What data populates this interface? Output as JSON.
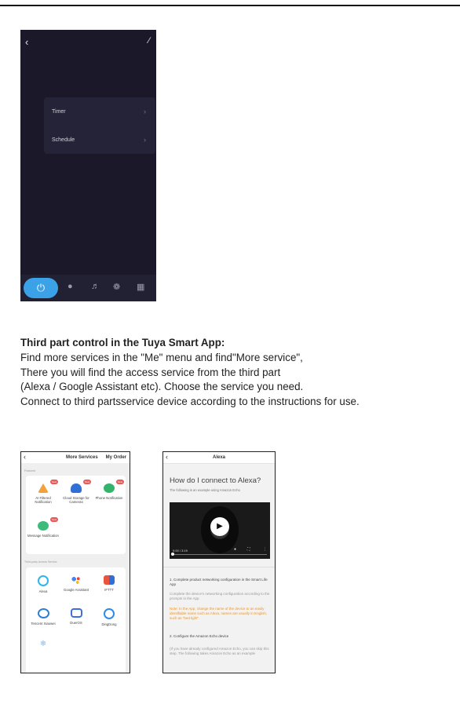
{
  "phone1": {
    "back_icon": "chevron-left-icon",
    "edit_icon": "pencil-icon",
    "rows": [
      {
        "label": "Timer"
      },
      {
        "label": "Schedule"
      }
    ],
    "bottom_icons": [
      "power-icon",
      "bulb-icon",
      "music-icon",
      "palette-icon",
      "grid-icon"
    ],
    "accent_color": "#3ba2e8",
    "background_color": "#1b1929"
  },
  "instructions": {
    "title": "Third part control in the Tuya Smart App:",
    "lines": [
      "Find more services in the \"Me\" menu and find\"More service\",",
      "There you will find the access service from the third part",
      "(Alexa / Google Assistant etc).  Choose the service you need.",
      "Connect to third partsservice device according to the instructions for use."
    ]
  },
  "phone2": {
    "title": "More Services",
    "order": "My Order",
    "featured_label": "Featured",
    "featured": [
      {
        "label": "AI Filtered Notification",
        "icon": "ai-filter-icon",
        "color": "#f2a23a",
        "badge": "New"
      },
      {
        "label": "Cloud Storage for Cameras",
        "icon": "cloud-icon",
        "color": "#2f6fd6",
        "badge": "New"
      },
      {
        "label": "Phone Notification",
        "icon": "phone-icon",
        "color": "#34b36b",
        "badge": "New"
      },
      {
        "label": "Message Notification",
        "icon": "message-icon",
        "color": "#3dbb7a",
        "badge": "New"
      }
    ],
    "third_party_label": "Third-party Access Service",
    "third_party": [
      {
        "label": "Alexa",
        "icon": "alexa-icon",
        "color": "#2fb5e8"
      },
      {
        "label": "Google Assistant",
        "icon": "google-assistant-icon",
        "color": "#4285f4"
      },
      {
        "label": "IFTTT",
        "icon": "ifttt-icon",
        "color": "#e8553a"
      },
      {
        "label": "Tencent Xiaowei",
        "icon": "tencent-icon",
        "color": "#2f7fd6"
      },
      {
        "label": "DuerOS",
        "icon": "dueros-icon",
        "color": "#3d6fe0"
      },
      {
        "label": "DingDong",
        "icon": "dingdong-icon",
        "color": "#2f8ae8"
      }
    ]
  },
  "phone3": {
    "title": "Alexa",
    "heading": "How do I connect to Alexa?",
    "subheading": "The following is an example using Amazon Echo",
    "video_time": "0:00 / 3:19",
    "step1_title": "1. Complete product networking configuration in the Smart Life App",
    "step1_body": "Complete the device's networking configuration according to the prompts in the App",
    "step1_note": "Note: In the App, change the name of the device to an easily identifiable name such as Alexa, names are usually in English, such as \"bed light\"",
    "step2_title": "2. Configure the Amazon Echo device",
    "step2_body": "(If you have already configured Amazon Echo, you can skip this step. The following takes Amazon Echo as an example"
  }
}
